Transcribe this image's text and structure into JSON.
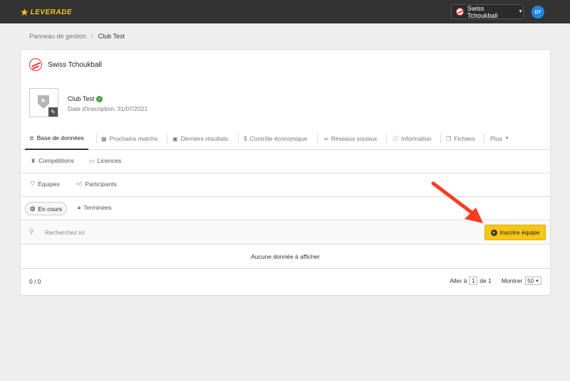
{
  "topbar": {
    "logo_text": "LEVERADE",
    "org_name": "Swiss Tchoukball",
    "avatar_initials": "DT"
  },
  "breadcrumb": {
    "items": [
      "Panneau de gestion",
      "Club Test"
    ]
  },
  "federation": {
    "name": "Swiss Tchoukball"
  },
  "club": {
    "name": "Club Test",
    "registration_date": "Date d'inscription: 31/07/2021"
  },
  "tabs": [
    {
      "label": "Base de données",
      "icon": "database-icon",
      "active": true
    },
    {
      "label": "Prochains matchs",
      "icon": "calendar-icon"
    },
    {
      "label": "Derniers résultats",
      "icon": "calendar-check-icon"
    },
    {
      "label": "Contrôle économique",
      "icon": "dollar-icon"
    },
    {
      "label": "Réseaux sociaux",
      "icon": "share-icon"
    },
    {
      "label": "Information",
      "icon": "info-icon"
    },
    {
      "label": "Fichiers",
      "icon": "files-icon"
    },
    {
      "label": "Plus",
      "icon": "chevron-down-icon"
    }
  ],
  "subnav1": [
    {
      "label": "Compétitions",
      "icon": "trophy-icon"
    },
    {
      "label": "Licences",
      "icon": "id-card-icon"
    }
  ],
  "subnav2": [
    {
      "label": "Équipes",
      "icon": "shield-icon"
    },
    {
      "label": "Participants",
      "icon": "thumbs-up-icon"
    }
  ],
  "filters": [
    {
      "label": "En cours",
      "icon": "globe-icon",
      "active": true
    },
    {
      "label": "Terminées",
      "icon": "lock-icon"
    }
  ],
  "search": {
    "placeholder": "Recherchez ici"
  },
  "register_button": {
    "label": "Inscrire équipe"
  },
  "empty_message": "Aucune donnée à afficher",
  "pagination": {
    "count": "0 / 0",
    "goto_label": "Aller à",
    "current_page": "1",
    "of_label": "de 1",
    "show_label": "Montrer",
    "per_page": "50"
  },
  "colors": {
    "topbar": "#333333",
    "accent": "#f5c518",
    "arrow": "#ff3b1f",
    "avatar": "#1e88e5"
  }
}
